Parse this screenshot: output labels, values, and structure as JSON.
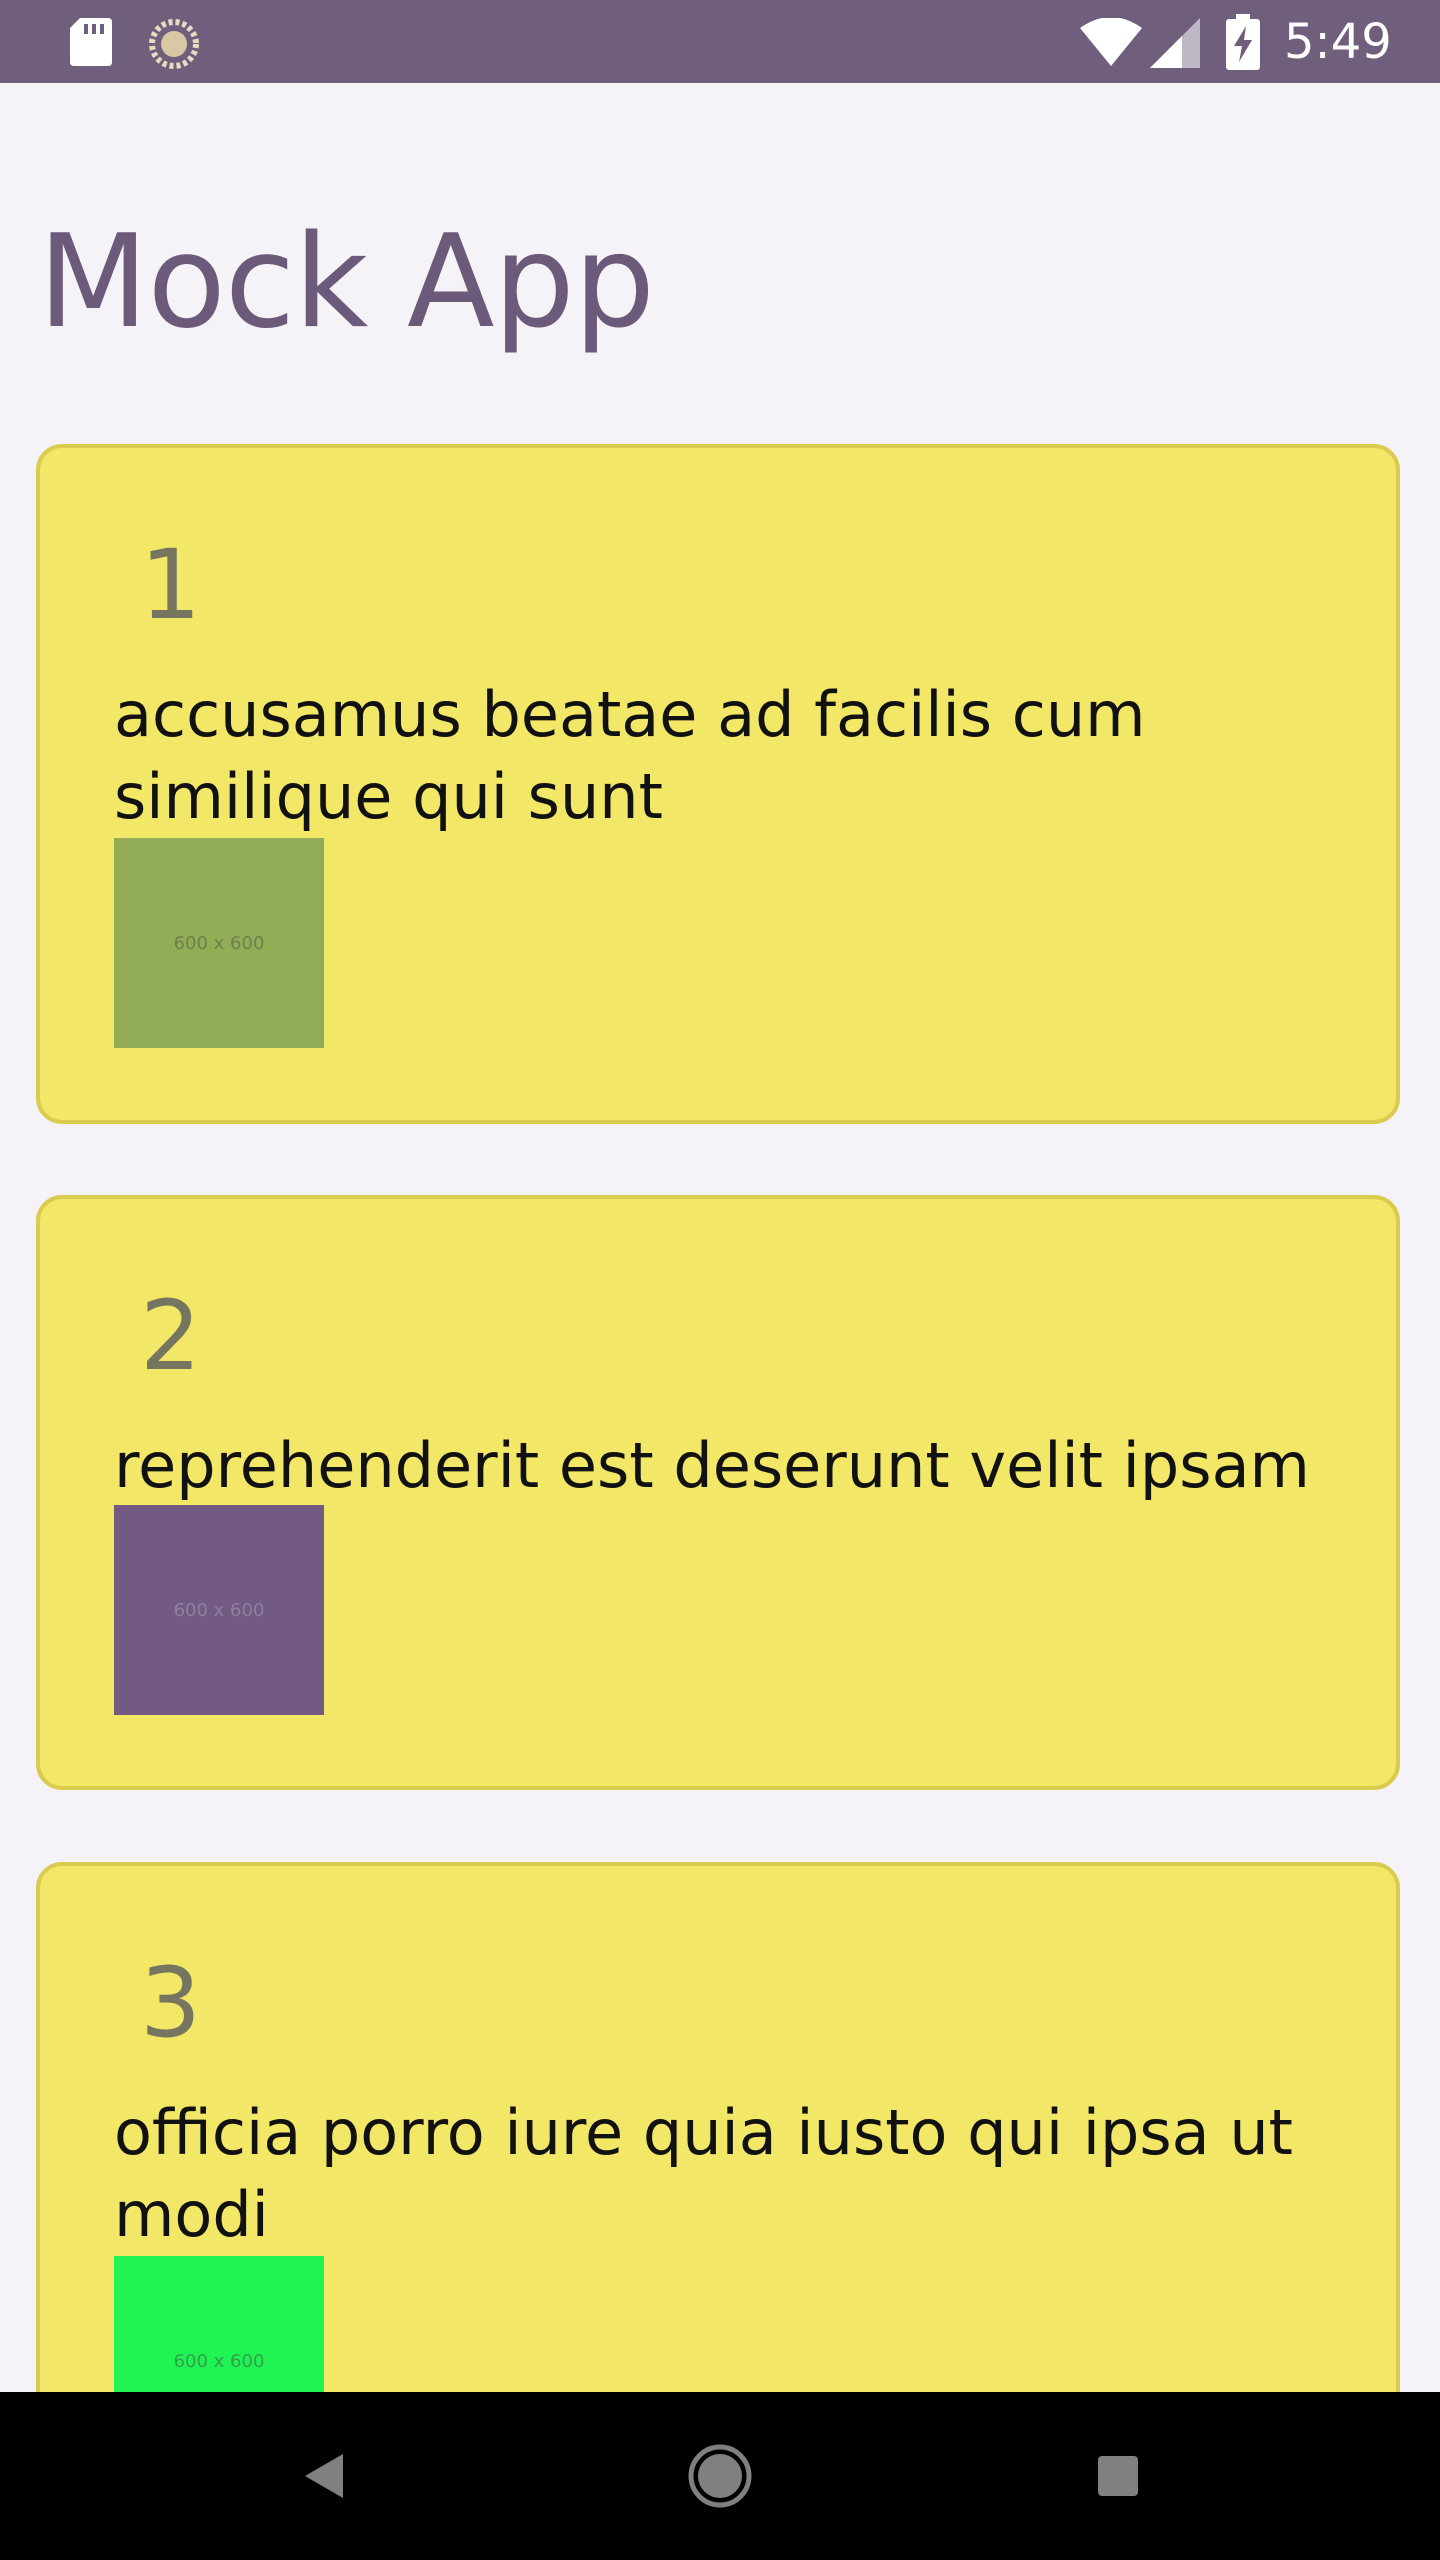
{
  "status_bar": {
    "time": "5:49",
    "icons": [
      "sd-card-icon",
      "sync-icon",
      "wifi-icon",
      "signal-icon",
      "battery-charging-icon"
    ]
  },
  "app": {
    "title": "Mock App"
  },
  "cards": [
    {
      "number": "1",
      "text": "accusamus beatae ad facilis cum similique qui sunt",
      "thumbnail_label": "600 x 600",
      "thumbnail_color": "#92ad55"
    },
    {
      "number": "2",
      "text": "reprehenderit est deserunt velit ipsam",
      "thumbnail_label": "600 x 600",
      "thumbnail_color": "#725a82"
    },
    {
      "number": "3",
      "text": "officia porro iure quia iusto qui ipsa ut modi",
      "thumbnail_label": "600 x 600",
      "thumbnail_color": "#1ff452"
    }
  ],
  "nav_bar": {
    "buttons": [
      "back-icon",
      "home-icon",
      "recents-icon"
    ]
  },
  "colors": {
    "status_bar": "#6f5f7d",
    "title": "#6c5a7a",
    "card_background": "#f2e766",
    "card_border": "#d9cb4e",
    "background": "#f5f3f7"
  }
}
